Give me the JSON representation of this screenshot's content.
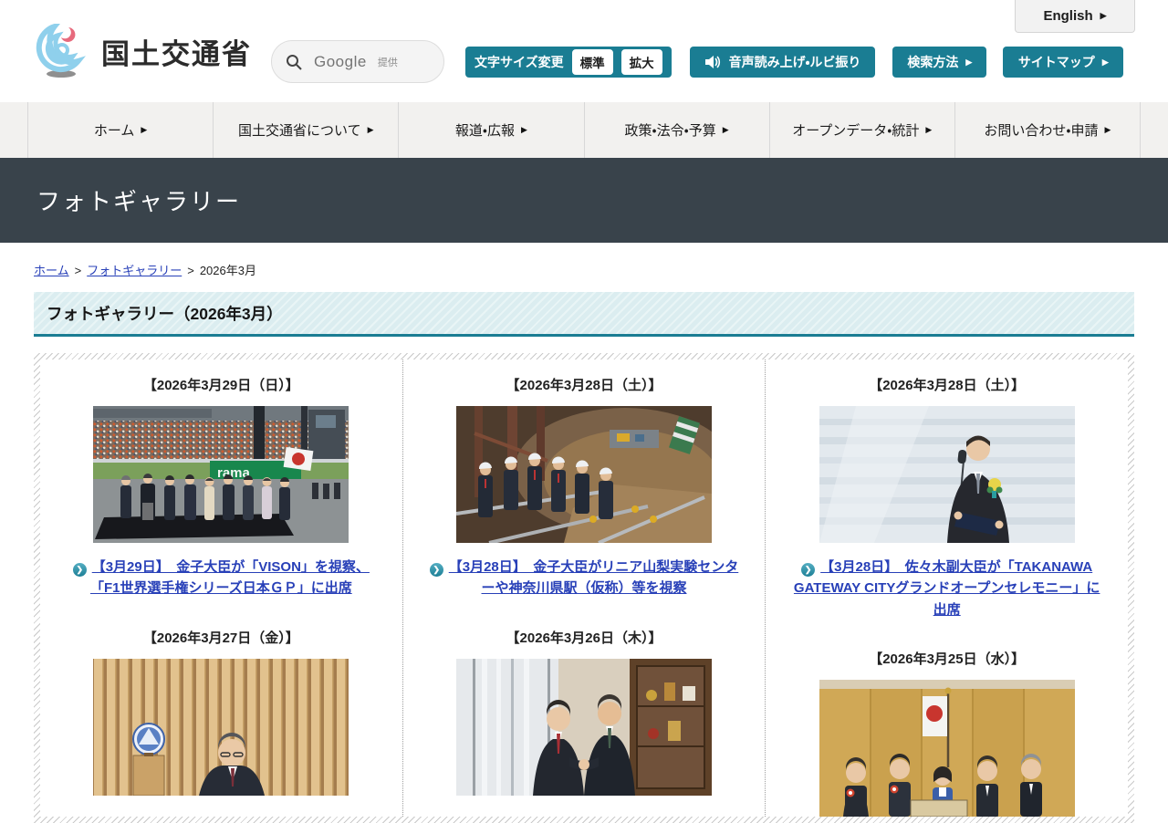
{
  "ui": {
    "arrow": "▶",
    "chevron": "❯",
    "gt": ">"
  },
  "header": {
    "site_name": "国土交通省",
    "english_label": "English",
    "search_brand": "Google",
    "search_provided": "提供",
    "font_size_label": "文字サイズ変更",
    "font_standard_label": "標準",
    "font_large_label": "拡大",
    "audio_label": "音声読み上げ・ルビ振り",
    "search_method_label": "検索方法",
    "sitemap_label": "サイトマップ"
  },
  "nav": {
    "items": [
      "ホーム",
      "国土交通省について",
      "報道・広報",
      "政策・法令・予算",
      "オープンデータ・統計",
      "お問い合わせ・申請"
    ]
  },
  "banner": {
    "title": "フォトギャラリー"
  },
  "breadcrumb": {
    "items": [
      "ホーム",
      "フォトギャラリー",
      "2026年3月"
    ]
  },
  "section": {
    "title": "フォトギャラリー（2026年3月）"
  },
  "gallery": {
    "items": [
      {
        "date": "【2026年3月29日（日）】",
        "link": "【3月29日】　金子大臣が「VISON」を視察、「F1世界選手権シリーズ日本ＧＰ」に出席",
        "photo_desc": "F1日本GPグリッド上の式典で並んで拍手する出席者"
      },
      {
        "date": "【2026年3月28日（土）】",
        "link": "【3月28日】　金子大臣がリニア山梨実験センターや神奈川県駅（仮称）等を視察",
        "photo_desc": "ヘルメット姿でトンネル工事現場を視察する一行"
      },
      {
        "date": "【2026年3月28日（土）】",
        "link": "【3月28日】　佐々木副大臣が「TAKANAWA GATEWAY CITYグランドオープンセレモニー」に出席",
        "photo_desc": "胸章を着けてマイクの前で挨拶する副大臣"
      },
      {
        "date": "【2026年3月27日（金）】",
        "photo_desc": "木格子の前で会見する大臣"
      },
      {
        "date": "【2026年3月26日（木）】",
        "photo_desc": "執務室で握手を交わす二人"
      },
      {
        "date": "【2026年3月25日（水）】",
        "photo_desc": "金屏風と国旗の前での記念撮影"
      }
    ]
  },
  "colors": {
    "accent_teal": "#1a7d93",
    "banner_dark": "#39434b",
    "link_blue": "#2840b8"
  }
}
